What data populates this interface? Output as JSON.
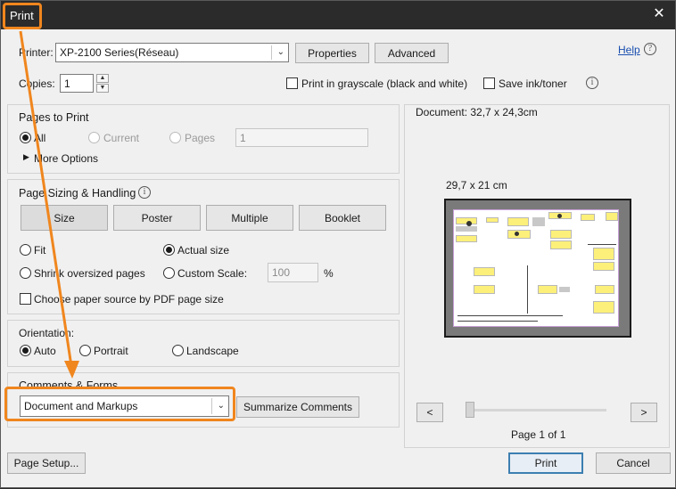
{
  "window": {
    "title": "Print",
    "close_glyph": "✕"
  },
  "header": {
    "printer_label": "Printer:",
    "printer_value": "XP-2100 Series(Réseau)",
    "properties_label": "Properties",
    "advanced_label": "Advanced",
    "help_label": "Help",
    "copies_label": "Copies:",
    "copies_value": "1",
    "grayscale_label": "Print in grayscale (black and white)",
    "grayscale_checked": false,
    "save_ink_label": "Save ink/toner",
    "save_ink_checked": false
  },
  "pages_to_print": {
    "title": "Pages to Print",
    "all_label": "All",
    "current_label": "Current",
    "pages_label": "Pages",
    "pages_value": "1",
    "selected": "All",
    "more_options_label": "More Options"
  },
  "sizing": {
    "title": "Page Sizing & Handling",
    "tabs": [
      "Size",
      "Poster",
      "Multiple",
      "Booklet"
    ],
    "active_tab": "Size",
    "fit_label": "Fit",
    "actual_size_label": "Actual size",
    "shrink_label": "Shrink oversized pages",
    "custom_scale_label": "Custom Scale:",
    "custom_scale_value": "100",
    "percent_label": "%",
    "selected": "Actual size",
    "paper_source_label": "Choose paper source by PDF page size",
    "paper_source_checked": false
  },
  "orientation": {
    "title": "Orientation:",
    "auto_label": "Auto",
    "portrait_label": "Portrait",
    "landscape_label": "Landscape",
    "selected": "Auto"
  },
  "comments_forms": {
    "title": "Comments & Forms",
    "value": "Document and Markups",
    "summarize_label": "Summarize Comments"
  },
  "preview": {
    "document_size": "Document: 32,7 x 24,3cm",
    "paper_size": "29,7 x 21 cm",
    "prev_glyph": "<",
    "next_glyph": ">",
    "page_counter": "Page 1 of 1"
  },
  "footer": {
    "page_setup_label": "Page Setup...",
    "print_label": "Print",
    "cancel_label": "Cancel"
  },
  "colors": {
    "highlight": "#f0861e",
    "titlebar": "#2b2b2b",
    "primary_border": "#3c7fb1",
    "preview_yellow": "#fdf07a"
  }
}
